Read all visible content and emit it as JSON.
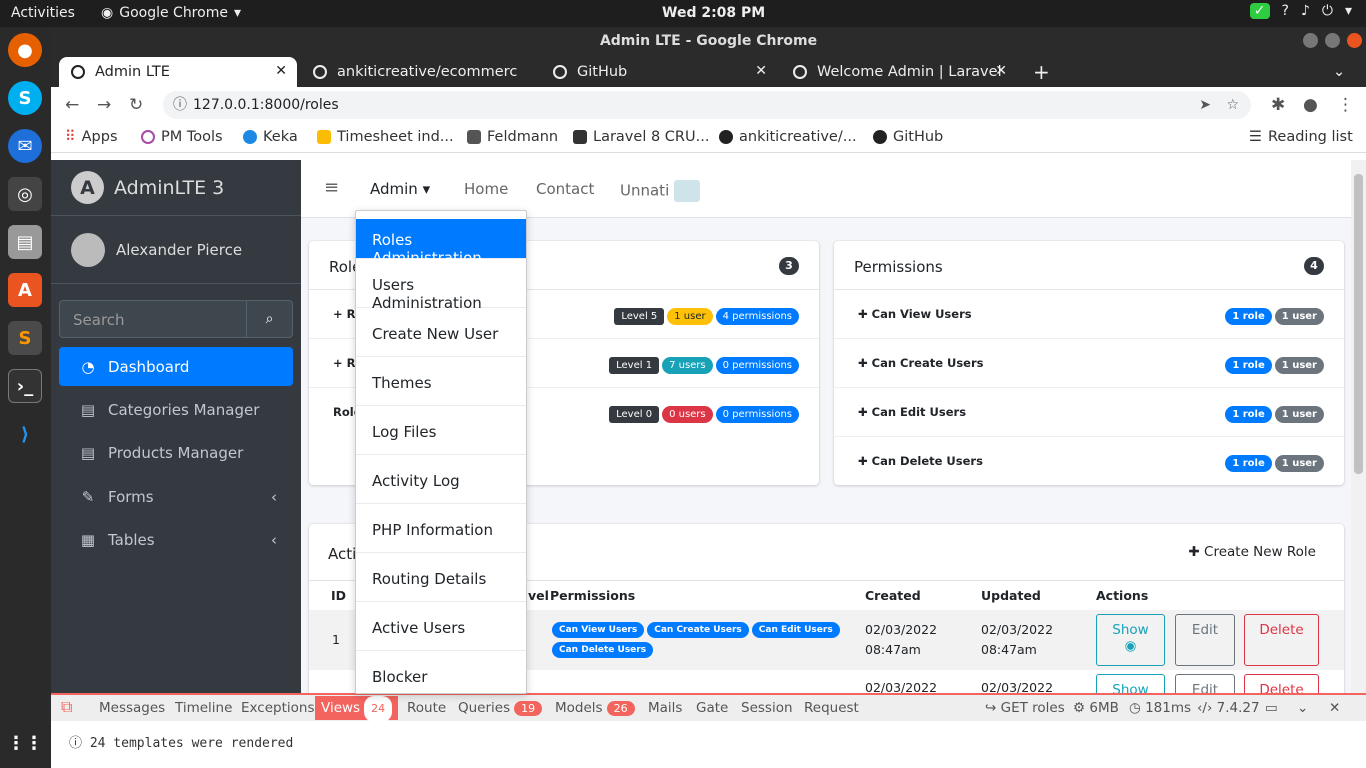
{
  "os": {
    "activities": "Activities",
    "app_name": "Google Chrome",
    "clock": "Wed  2:08 PM"
  },
  "window": {
    "title": "Admin LTE - Google Chrome"
  },
  "tabs": [
    {
      "label": "Admin LTE"
    },
    {
      "label": "ankiticreative/ecommerce"
    },
    {
      "label": "GitHub"
    },
    {
      "label": "Welcome Admin | Laravel"
    }
  ],
  "url": "127.0.0.1:8000/roles",
  "bookmarks": [
    "Apps",
    "PM Tools",
    "Keka",
    "Timesheet ind...",
    "Feldmann",
    "Laravel 8 CRU...",
    "ankiticreative/...",
    "GitHub"
  ],
  "reading_list": "Reading list",
  "sidebar": {
    "brand": "AdminLTE 3",
    "user": "Alexander Pierce",
    "search_placeholder": "Search",
    "items": [
      {
        "label": "Dashboard",
        "icon": "dashboard-icon"
      },
      {
        "label": "Categories Manager",
        "icon": "list-icon"
      },
      {
        "label": "Products Manager",
        "icon": "list-icon"
      },
      {
        "label": "Forms",
        "icon": "edit-icon"
      },
      {
        "label": "Tables",
        "icon": "table-icon"
      }
    ]
  },
  "navbar": {
    "admin": "Admin",
    "home": "Home",
    "contact": "Contact",
    "user": "Unnati"
  },
  "dropdown": [
    "Roles Administration",
    "Users Administration",
    "Create New User",
    "Themes",
    "Log Files",
    "Activity Log",
    "PHP Information",
    "Routing Details",
    "Active Users",
    "Blocker"
  ],
  "roles_card": {
    "title": "Role",
    "count": "3",
    "rows": [
      {
        "label": "+  R",
        "level": "Level 5",
        "users": "1 user",
        "perms": "4 permissions"
      },
      {
        "label": "+  R",
        "level": "Level 1",
        "users": "7 users",
        "perms": "0 permissions"
      },
      {
        "label": "Role",
        "level": "Level 0",
        "users": "0 users",
        "perms": "0 permissions"
      }
    ]
  },
  "permissions_card": {
    "title": "Permissions",
    "count": "4",
    "rows": [
      {
        "label": "Can View Users",
        "roles": "1 role",
        "users": "1 user"
      },
      {
        "label": "Can Create Users",
        "roles": "1 role",
        "users": "1 user"
      },
      {
        "label": "Can Edit Users",
        "roles": "1 role",
        "users": "1 user"
      },
      {
        "label": "Can Delete Users",
        "roles": "1 role",
        "users": "1 user"
      }
    ]
  },
  "table": {
    "title": "Activ",
    "create": "Create New Role",
    "headers": {
      "id": "ID",
      "level": "vel",
      "permissions": "Permissions",
      "created": "Created",
      "updated": "Updated",
      "actions": "Actions"
    },
    "row1": {
      "id": "1",
      "perms": [
        "Can View Users",
        "Can Create Users",
        "Can Edit Users",
        "Can Delete Users"
      ],
      "created1": "02/03/2022",
      "created2": "08:47am",
      "updated1": "02/03/2022",
      "updated2": "08:47am"
    },
    "row2": {
      "created1": "02/03/2022",
      "updated1": "02/03/2022"
    },
    "buttons": {
      "show": "Show",
      "edit": "Edit",
      "delete": "Delete"
    }
  },
  "debugbar": {
    "tabs": [
      "Messages",
      "Timeline",
      "Exceptions",
      "Views",
      "Route",
      "Queries",
      "Models",
      "Mails",
      "Gate",
      "Session",
      "Request"
    ],
    "views_count": "24",
    "queries_count": "19",
    "models_count": "26",
    "route": "GET roles",
    "memory": "6MB",
    "time": "181ms",
    "php": "7.4.27",
    "message": "24 templates were rendered"
  }
}
